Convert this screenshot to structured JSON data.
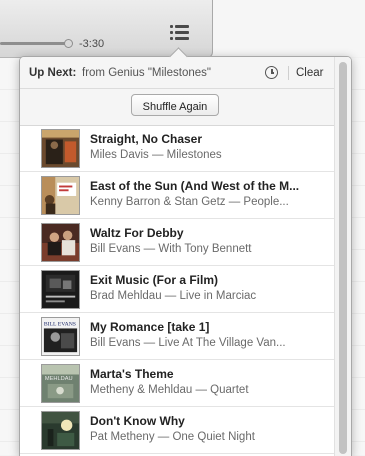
{
  "player": {
    "time_remaining": "-3:30",
    "progress_fraction": 0.95
  },
  "up_next": {
    "label": "Up Next:",
    "source": "from Genius \"Milestones\"",
    "clear_label": "Clear",
    "shuffle_label": "Shuffle Again",
    "tracks": [
      {
        "title": "Straight, No Chaser",
        "subtitle": "Miles Davis — Milestones"
      },
      {
        "title": "East of the Sun (And West of the M...",
        "subtitle": "Kenny Barron & Stan Getz — People..."
      },
      {
        "title": "Waltz For Debby",
        "subtitle": "Bill Evans — With Tony Bennett"
      },
      {
        "title": "Exit Music (For a Film)",
        "subtitle": "Brad Mehldau — Live in Marciac"
      },
      {
        "title": "My Romance [take 1]",
        "subtitle": "Bill Evans — Live At The Village Van..."
      },
      {
        "title": "Marta's Theme",
        "subtitle": "Metheny & Mehldau — Quartet"
      },
      {
        "title": "Don't Know Why",
        "subtitle": "Pat Metheny — One Quiet Night"
      }
    ]
  },
  "art_labels": {
    "bill_evans": "BILL EVANS",
    "mehldau": "MEHLDAU"
  },
  "colors": {
    "header_bg": "#f5f5f5",
    "title_text": "#222222",
    "subtitle_text": "#6a6a6a"
  }
}
